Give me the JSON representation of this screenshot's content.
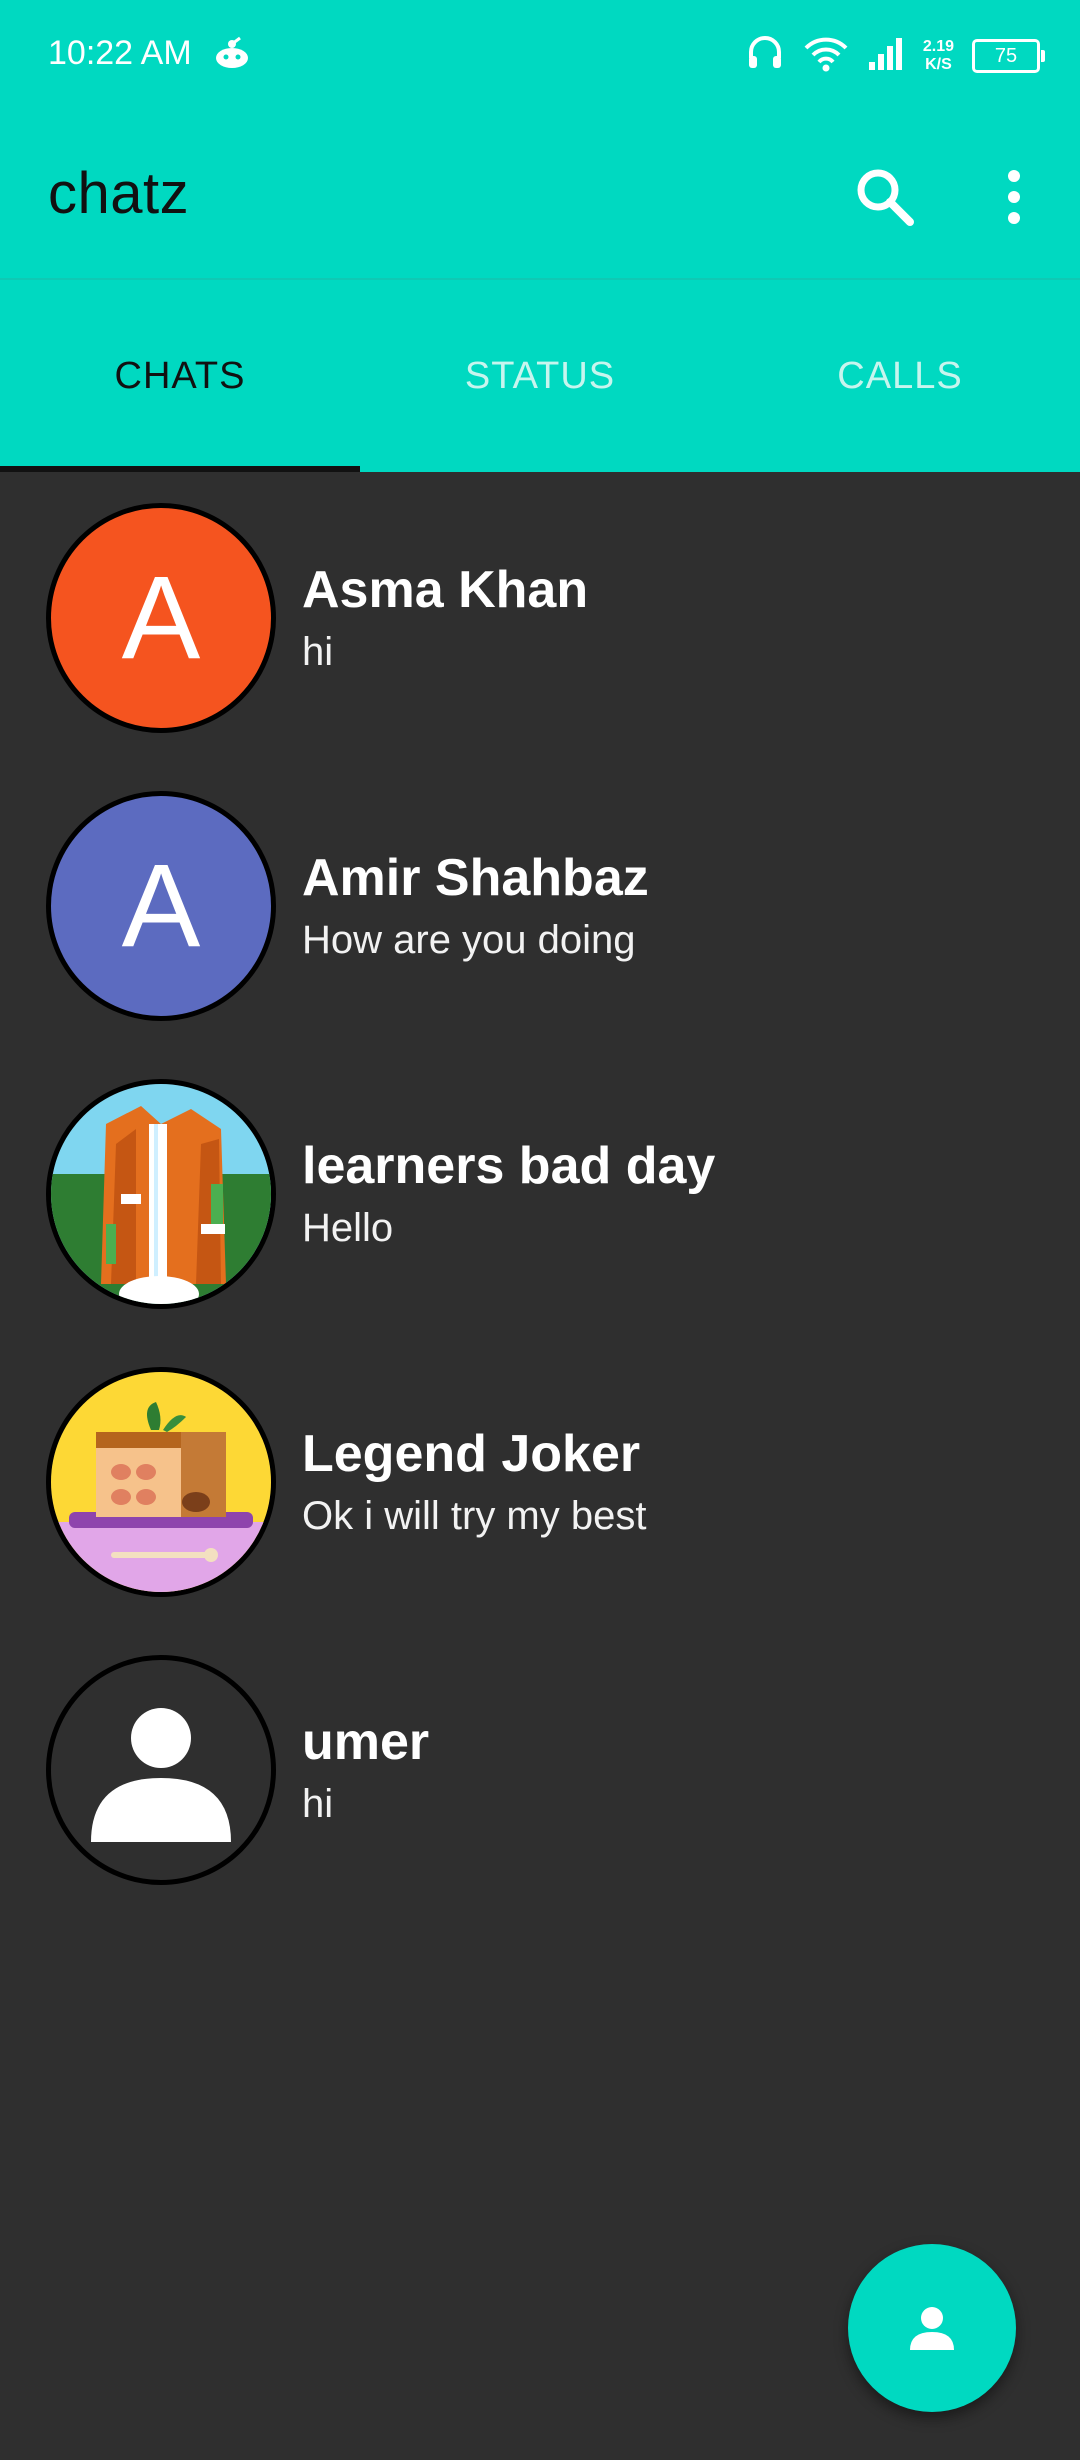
{
  "status_bar": {
    "time": "10:22 AM",
    "net_speed_value": "2.19",
    "net_speed_unit": "K/S",
    "battery": "75",
    "icons": [
      "app-notification-icon",
      "headset-icon",
      "wifi-icon",
      "signal-icon",
      "battery-icon"
    ]
  },
  "app_bar": {
    "title": "chatz",
    "actions": [
      "search-icon",
      "more-vert-icon"
    ]
  },
  "tabs": [
    {
      "label": "CHATS",
      "active": true
    },
    {
      "label": "STATUS",
      "active": false
    },
    {
      "label": "CALLS",
      "active": false
    }
  ],
  "chats": [
    {
      "name": "Asma Khan",
      "last_message": "hi",
      "avatar": {
        "type": "letter",
        "letter": "A",
        "color": "#f5541f"
      }
    },
    {
      "name": "Amir Shahbaz",
      "last_message": "How are you doing",
      "avatar": {
        "type": "letter",
        "letter": "A",
        "color": "#5c6bc0"
      }
    },
    {
      "name": "learners bad day",
      "last_message": "Hello",
      "avatar": {
        "type": "image",
        "icon": "waterfall-landscape-image"
      }
    },
    {
      "name": "Legend Joker",
      "last_message": "Ok i will try my best",
      "avatar": {
        "type": "image",
        "icon": "cake-dessert-image"
      }
    },
    {
      "name": "umer",
      "last_message": "hi",
      "avatar": {
        "type": "image",
        "icon": "default-person-icon"
      }
    }
  ],
  "fab": {
    "icon": "person-icon"
  },
  "colors": {
    "accent": "#00d9c1",
    "background": "#2f2f2f",
    "tab_indicator": "#111111"
  }
}
